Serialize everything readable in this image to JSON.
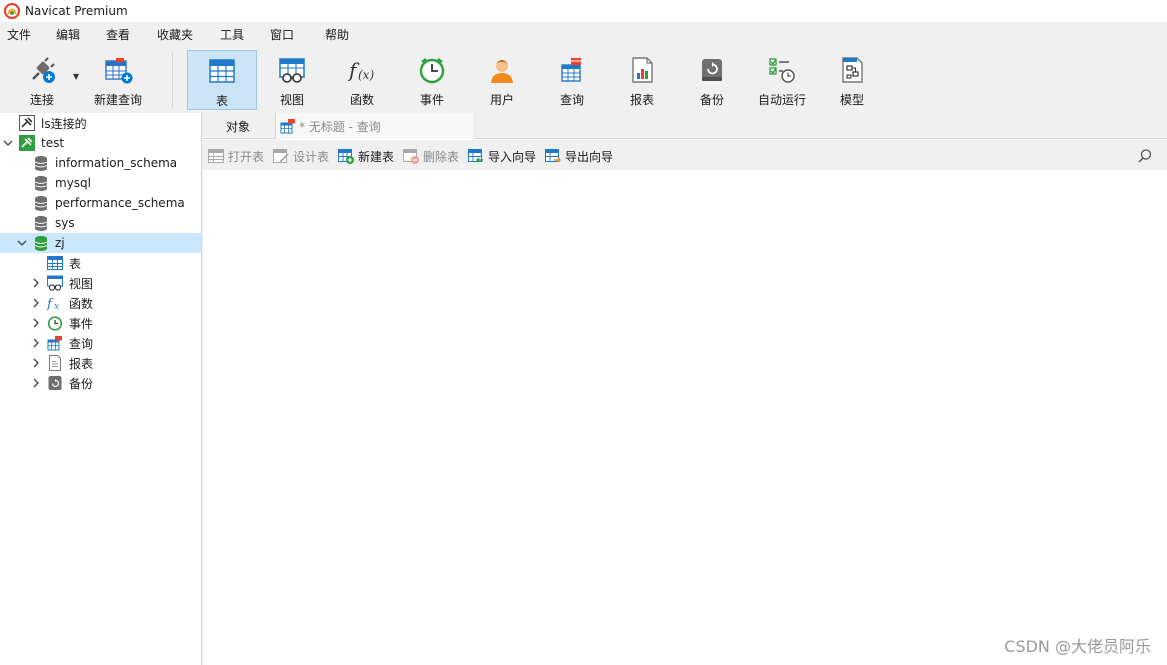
{
  "window": {
    "title": "Navicat Premium"
  },
  "menu": [
    "文件",
    "编辑",
    "查看",
    "收藏夹",
    "工具",
    "窗口",
    "帮助"
  ],
  "toolbar": {
    "connect": "连接",
    "new_query": "新建查询",
    "table": "表",
    "view": "视图",
    "function": "函数",
    "event": "事件",
    "user": "用户",
    "query": "查询",
    "report": "报表",
    "backup": "备份",
    "automation": "自动运行",
    "model": "模型"
  },
  "tree": {
    "conn_ls": "ls连接的",
    "conn_test": "test",
    "db_information_schema": "information_schema",
    "db_mysql": "mysql",
    "db_performance_schema": "performance_schema",
    "db_sys": "sys",
    "db_zj": "zj",
    "node_tables": "表",
    "node_views": "视图",
    "node_functions": "函数",
    "node_events": "事件",
    "node_queries": "查询",
    "node_reports": "报表",
    "node_backups": "备份"
  },
  "tabs": {
    "objects": "对象",
    "query_tab": "* 无标题 - 查询"
  },
  "object_toolbar": {
    "open_table": "打开表",
    "design_table": "设计表",
    "new_table": "新建表",
    "delete_table": "删除表",
    "import_wizard": "导入向导",
    "export_wizard": "导出向导"
  },
  "watermark": "CSDN @大佬员阿乐",
  "colors": {
    "accent": "#0078d7",
    "selected_bg": "#cce8ff",
    "toolbar_active": "#cce4f7",
    "db_green": "#2e9e3e"
  }
}
